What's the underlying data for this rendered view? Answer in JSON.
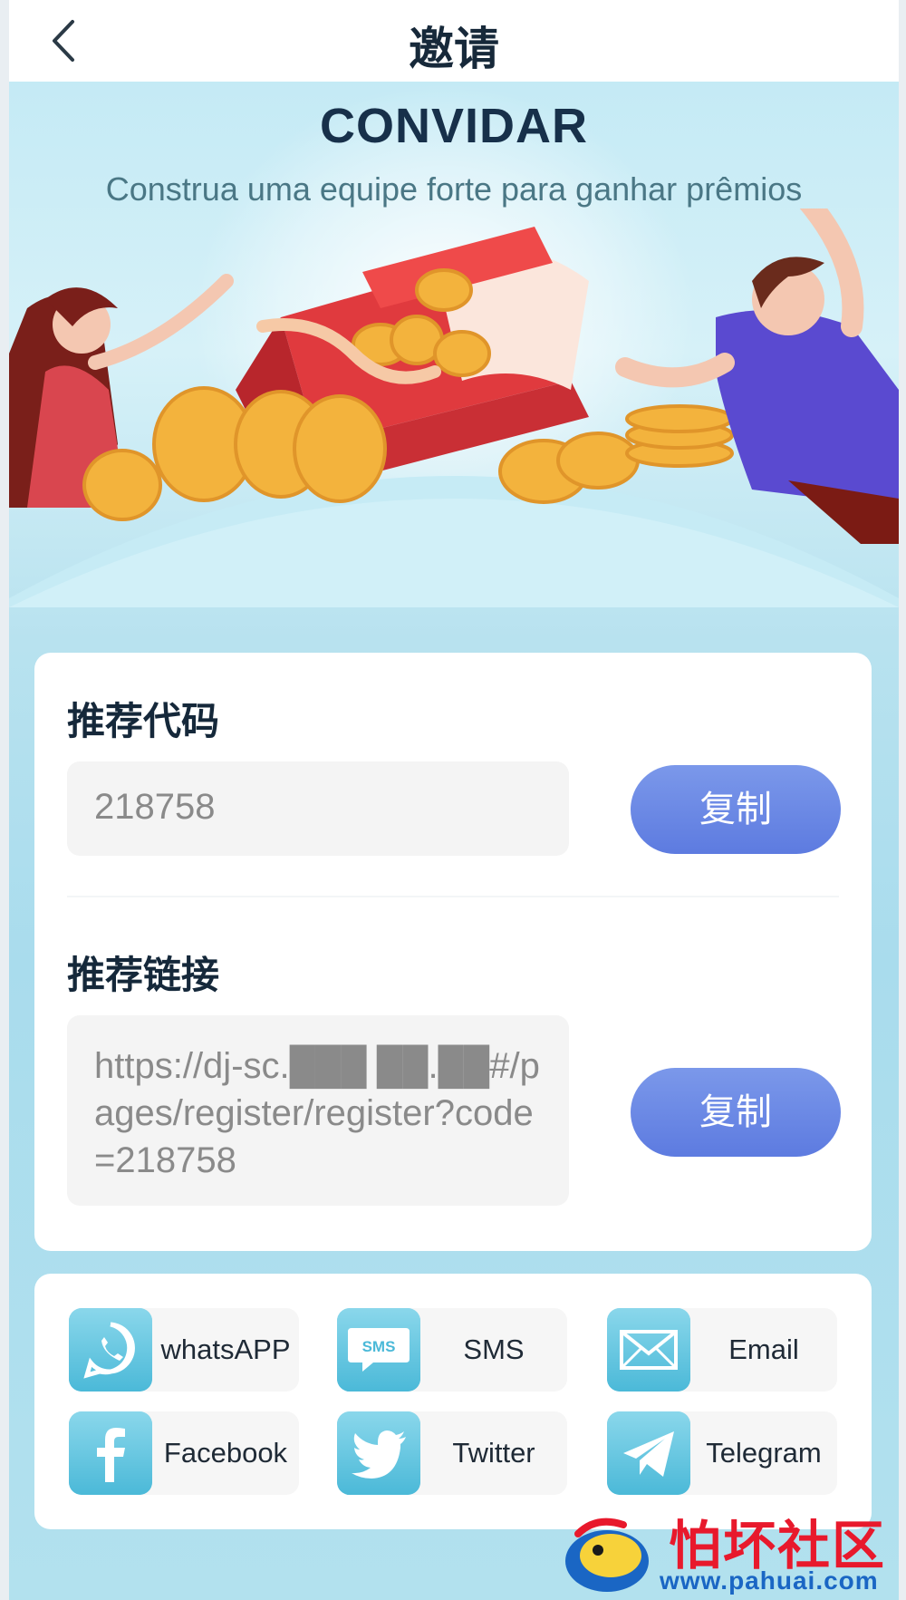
{
  "header": {
    "title": "邀请"
  },
  "hero": {
    "title": "CONVIDAR",
    "subtitle": "Construa uma equipe forte para ganhar prêmios"
  },
  "referral": {
    "code_label": "推荐代码",
    "code_value": "218758",
    "link_label": "推荐链接",
    "link_value": "https://dj-sc.███ ██.██#/pages/register/register?code=218758",
    "copy_label": "复制"
  },
  "share": {
    "items": [
      {
        "label": "whatsAPP",
        "icon": "whatsapp-icon"
      },
      {
        "label": "SMS",
        "icon": "sms-icon"
      },
      {
        "label": "Email",
        "icon": "email-icon"
      },
      {
        "label": "Facebook",
        "icon": "facebook-icon"
      },
      {
        "label": "Twitter",
        "icon": "twitter-icon"
      },
      {
        "label": "Telegram",
        "icon": "telegram-icon"
      }
    ],
    "sms_icon_text": "SMS"
  },
  "watermark": {
    "text": "怕坏社区",
    "url": "www.pahuai.com"
  },
  "colors": {
    "accent": "#5d7be0",
    "title": "#17304a",
    "share_icon": "#4dbad9",
    "watermark_red": "#e8192c",
    "watermark_blue": "#1a66c4"
  }
}
